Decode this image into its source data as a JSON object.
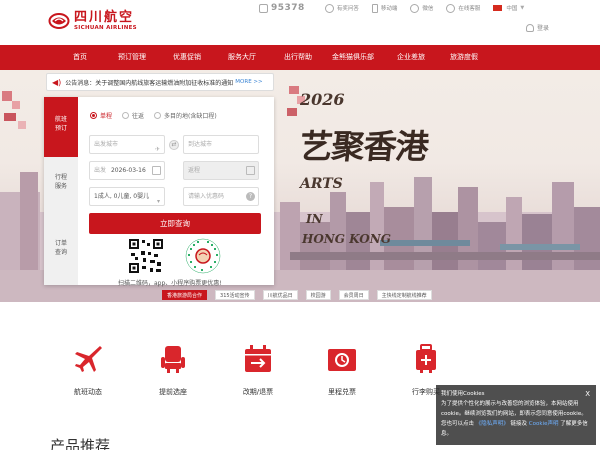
{
  "brand": {
    "name_cn": "四川航空",
    "name_en": "SICHUAN AIRLINES"
  },
  "header": {
    "hotline": "95378",
    "links": [
      {
        "icon": "feedback-icon",
        "label": "有奖问答"
      },
      {
        "icon": "mobile-icon",
        "label": "移动端"
      },
      {
        "icon": "wechat-icon",
        "label": "微信"
      },
      {
        "icon": "service-icon",
        "label": "在线客服"
      }
    ],
    "language": "中国",
    "login": "登录"
  },
  "nav": {
    "items": [
      "首页",
      "预订管理",
      "优惠促销",
      "服务大厅",
      "出行帮助",
      "金熊猫俱乐部",
      "企业差旅",
      "旅游度假"
    ]
  },
  "hero": {
    "year": "2026",
    "title": "艺聚香港",
    "subtitle_lines": [
      "ARTS",
      "IN",
      "HONG KONG"
    ]
  },
  "notice": {
    "text": "公告消息：关于调整国内航线旅客运输燃油附加征收标准的通知",
    "more": "MORE >>"
  },
  "booking": {
    "tabs": [
      "航班预订",
      "行程服务",
      "订单查询"
    ],
    "trip_types": [
      "单程",
      "往返",
      "多目的地(含缺口程)"
    ],
    "from_placeholder": "出发城市",
    "to_placeholder": "到达城市",
    "depart_label": "出发",
    "depart_date": "2026-03-16",
    "return_placeholder": "返程",
    "passengers": "1成人, 0儿童, 0婴儿",
    "promo_placeholder": "请输入优惠码",
    "submit": "立即查询",
    "qr_text": "扫描二维码，app、小程序购票更优惠!"
  },
  "hero_tags": [
    "香港旅游局合作",
    "315活动宣传",
    "川航优品日",
    "校园游",
    "会员周日",
    "主快线定制航线推荐"
  ],
  "services": [
    {
      "icon": "plane-icon",
      "label": "航班动态"
    },
    {
      "icon": "seat-icon",
      "label": "提前选座"
    },
    {
      "icon": "calendar-icon",
      "label": "改期/退票"
    },
    {
      "icon": "ticket-icon",
      "label": "里程兑票"
    },
    {
      "icon": "luggage-icon",
      "label": "行李购买"
    }
  ],
  "section_title": "产品推荐",
  "cookie": {
    "title": "我们使用Cookies",
    "body": "为了提供个性化的展示与改善您的浏览体验，本网站使用cookie。继续浏览我们的网站，即表示您同意使用cookie。您也可以点击",
    "link1": "《隐私声明》",
    "mid": "链接及",
    "link2": "Cookie声明",
    "end": "了解更多信息。",
    "close": "X"
  },
  "colors": {
    "brand_red": "#c8161d",
    "link_blue": "#3a84d4"
  }
}
